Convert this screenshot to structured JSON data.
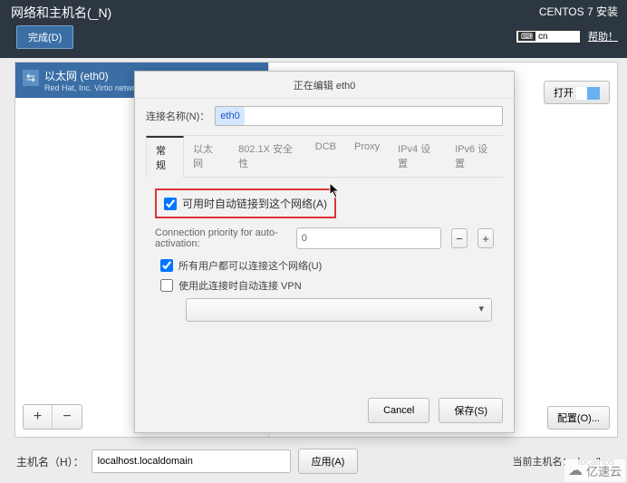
{
  "header": {
    "title": "网络和主机名(_N)",
    "done": "完成(D)",
    "right_title": "CENTOS 7 安装",
    "lang": "cn",
    "help": "帮助！"
  },
  "nic": {
    "title": "以太网 (eth0)",
    "subtitle": "Red Hat, Inc. Virtio network d"
  },
  "buttons": {
    "toggle": "打开",
    "config": "配置(O)...",
    "apply": "应用(A)",
    "add": "+",
    "remove": "−"
  },
  "hostname": {
    "label": "主机名（H）：",
    "value": "localhost.localdomain",
    "current_label": "当前主机名：",
    "current_value": "localhos"
  },
  "dialog": {
    "title": "正在编辑 eth0",
    "name_label": "连接名称(N)：",
    "name_value": "eth0",
    "tabs": [
      "常规",
      "以太网",
      "802.1X 安全性",
      "DCB",
      "Proxy",
      "IPv4 设置",
      "IPv6 设置"
    ],
    "auto_connect": "可用时自动链接到这个网络(A)",
    "priority_label": "Connection priority for auto-activation:",
    "priority_value": "0",
    "all_users": "所有用户都可以连接这个网络(U)",
    "auto_vpn": "使用此连接时自动连接 VPN",
    "cancel": "Cancel",
    "save": "保存(S)"
  },
  "watermark": "亿速云"
}
